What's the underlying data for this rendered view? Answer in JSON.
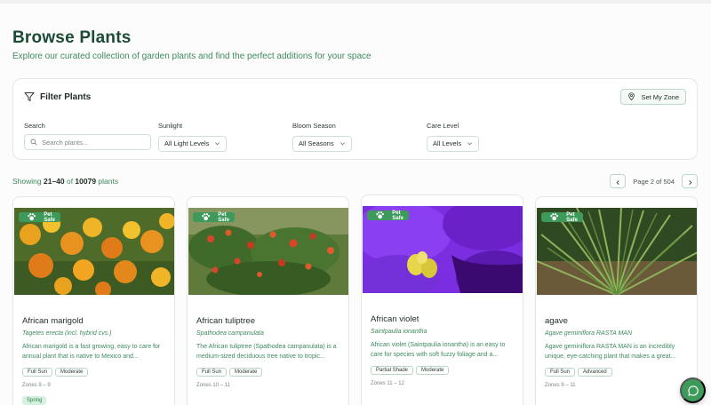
{
  "header": {
    "title": "Browse Plants",
    "subtitle": "Explore our curated collection of garden plants and find the perfect additions for your space"
  },
  "filters": {
    "title": "Filter Plants",
    "set_zone_label": "Set My Zone",
    "search": {
      "label": "Search",
      "placeholder": "Search plants...",
      "value": ""
    },
    "sunlight": {
      "label": "Sunlight",
      "value": "All Light Levels"
    },
    "bloom": {
      "label": "Bloom Season",
      "value": "All Seasons"
    },
    "care": {
      "label": "Care Level",
      "value": "All Levels"
    }
  },
  "results": {
    "prefix": "Showing ",
    "range": "21–40",
    "of": " of ",
    "total": "10079",
    "suffix": " plants"
  },
  "pagination": {
    "label": "Page 2 of 504"
  },
  "cards": [
    {
      "badge": "Pet Safe",
      "name": "African marigold",
      "scientific": "Tagetes erecta (incl. hybrid cvs.)",
      "description": "African marigold is a fast growing, easy to care for annual plant that is native to Mexico and...",
      "tags": [
        "Full Sun",
        "Moderate"
      ],
      "zones": "Zones 9 – 9",
      "season": "Spring"
    },
    {
      "badge": "Pet Safe",
      "name": "African tuliptree",
      "scientific": "Spathodea campanulata",
      "description": "The African tuliptree (Spathodea campanulata) is a medium-sized deciduous tree native to tropic...",
      "tags": [
        "Full Sun",
        "Moderate"
      ],
      "zones": "Zones 10 – 11"
    },
    {
      "badge": "Pet Safe",
      "name": "African violet",
      "scientific": "Saintpaulia ionantha",
      "description": "African violet (Saintpaulia ionantha) is an easy to care for species with soft fuzzy foliage and a...",
      "tags": [
        "Partial Shade",
        "Moderate"
      ],
      "zones": "Zones 11 – 12"
    },
    {
      "badge": "Pet Safe",
      "name": "agave",
      "scientific": "Agave geminiflora RASTA MAN",
      "description": "Agave geminiflora RASTA MAN is an incredibly unique, eye-catching plant that makes a great...",
      "tags": [
        "Full Sun",
        "Advanced"
      ],
      "zones": "Zones 9 – 11"
    }
  ],
  "colors": {
    "brand": "#3d9a5a",
    "title": "#1c4a34",
    "accent_text": "#3f8a5f"
  },
  "icons": [
    "filter-icon",
    "location-pin-icon",
    "search-icon",
    "chevron-down-icon",
    "chevron-left-icon",
    "chevron-right-icon",
    "paw-icon",
    "chat-icon"
  ]
}
